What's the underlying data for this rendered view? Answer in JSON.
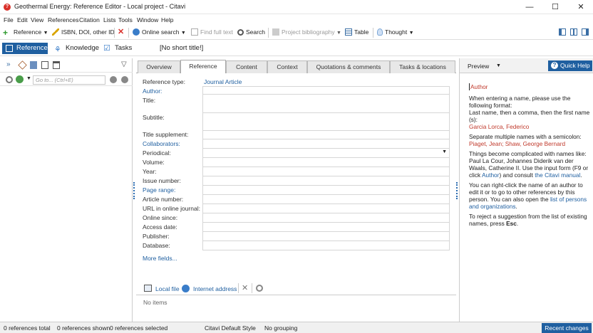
{
  "window": {
    "title": "Geothermal Energy: Reference Editor - Local project - Citavi",
    "app_icon": "citavi-icon",
    "minimize": "—",
    "maximize": "☐",
    "close": "✕"
  },
  "menu": [
    "File",
    "Edit",
    "View",
    "References",
    "Citation",
    "Lists",
    "Tools",
    "Window",
    "Help"
  ],
  "toolbar": {
    "reference": "Reference",
    "isbn": "ISBN, DOI, other ID",
    "online_search": "Online search",
    "find_full_text": "Find full text",
    "search": "Search",
    "project_bibliography": "Project bibliography",
    "table": "Table",
    "thought": "Thought"
  },
  "nav": {
    "references": "References",
    "knowledge": "Knowledge",
    "tasks": "Tasks",
    "short_title": "[No short title!]"
  },
  "left": {
    "search_placeholder": "Go to... (Ctrl+E)"
  },
  "tabs": [
    "Overview",
    "Reference",
    "Content",
    "Context",
    "Quotations & comments",
    "Tasks & locations"
  ],
  "active_tab": "Reference",
  "form": {
    "reference_type_label": "Reference type:",
    "reference_type_value": "Journal Article",
    "fields": [
      {
        "label": "Author:",
        "link": true
      },
      {
        "label": "Title:",
        "link": false
      },
      {
        "label": "Subtitle:",
        "link": false
      },
      {
        "label": "Title supplement:",
        "link": false
      },
      {
        "label": "Collaborators:",
        "link": true
      },
      {
        "label": "Periodical:",
        "link": false
      },
      {
        "label": "Volume:",
        "link": false
      },
      {
        "label": "Year:",
        "link": false
      },
      {
        "label": "Issue number:",
        "link": false
      },
      {
        "label": "Page range:",
        "link": true
      },
      {
        "label": "Article number:",
        "link": false
      },
      {
        "label": "URL in online journal:",
        "link": false
      },
      {
        "label": "Online since:",
        "link": false
      },
      {
        "label": "Access date:",
        "link": false
      },
      {
        "label": "Publisher:",
        "link": false
      },
      {
        "label": "Database:",
        "link": false
      }
    ],
    "more_fields": "More fields..."
  },
  "attachments": {
    "local_file": "Local file",
    "internet_address": "Internet address",
    "no_items": "No items"
  },
  "preview": {
    "label": "Preview",
    "quick_help": "Quick Help",
    "heading": "Author",
    "p1": "When entering a name, please use the following format:",
    "p1b": "Last name, then a comma, then the first name (s):",
    "ex1": "Garcia Lorca, Federico",
    "p2": "Separate multiple names with a semicolon:",
    "ex2": "Piaget, Jean; Shaw, George Bernard",
    "p3a": "Things become complicated with names like: Paul La Cour, Johannes Diderik van der Waals, Catherine II. Use the input form (F9 or click ",
    "p3link1": "Author",
    "p3b": ") and consult ",
    "p3link2": "the Citavi manual",
    "p3c": ".",
    "p4a": "You can right-click the name of an author to edit it or to go to other references by this person. You can also open the ",
    "p4link": "list of persons and organizations",
    "p4b": ".",
    "p5a": "To reject a suggestion from the list of existing names, press ",
    "p5key": "Esc",
    "p5b": "."
  },
  "status": {
    "total": "0 references total",
    "shown": "0 references shown",
    "selected": "0 references selected",
    "style": "Citavi Default Style",
    "grouping": "No grouping",
    "recent": "Recent changes"
  }
}
